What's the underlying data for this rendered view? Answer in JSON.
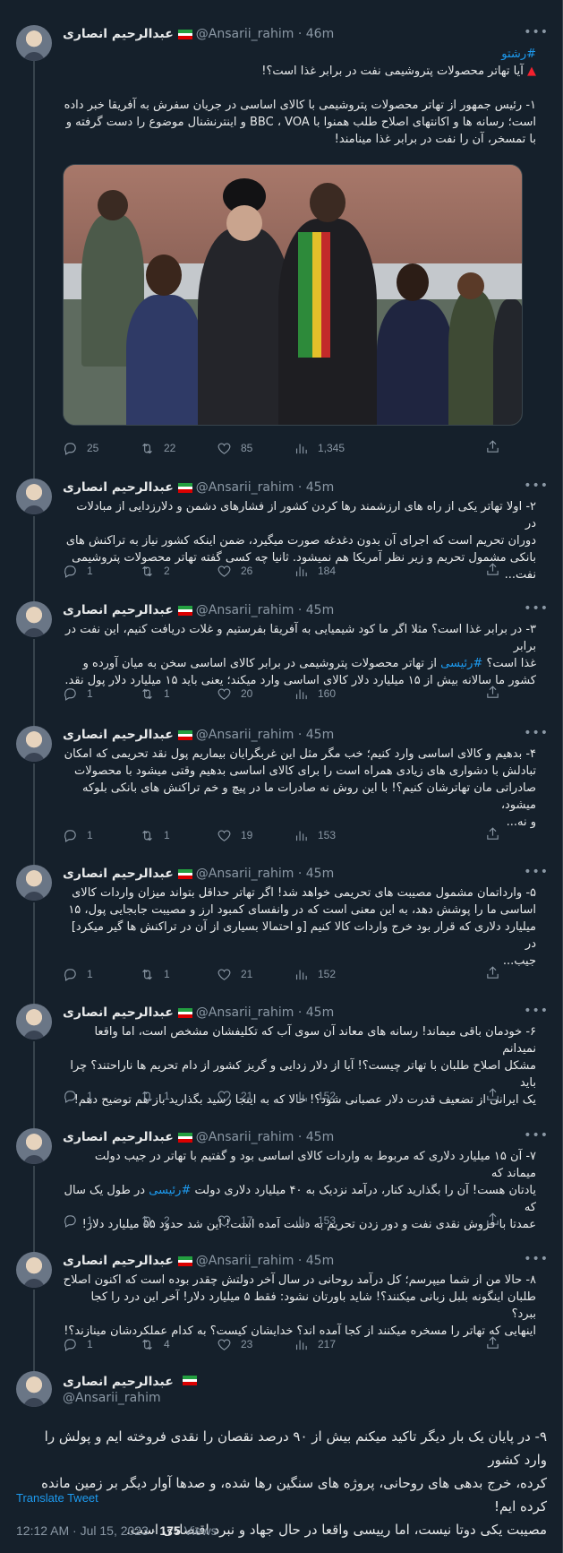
{
  "author": {
    "name": "عبدالرحیم انصاری",
    "handle": "@Ansarii_rahim"
  },
  "tweets": [
    {
      "time": "46m",
      "hashtag": "#رشتو",
      "title": "آیا تهاتر محصولات پتروشیمی نفت در برابر غذا است؟!",
      "lines": [
        "۱- رئیس جمهور از تهاتر محصولات پتروشیمی با کالای اساسی در جریان سفرش به آفریقا خبر داده",
        "است؛ رسانه ها و اکانتهای اصلاح طلب همنوا با BBC ، VOA و اینترنشنال موضوع را دست گرفته و",
        "با تمسخر، آن را نفت در برابر غذا مینامند!"
      ],
      "stats": {
        "replies": "25",
        "retweets": "22",
        "likes": "85",
        "views": "1,345"
      }
    },
    {
      "time": "45m",
      "lines": [
        "۲- اولا تهاتر یکی از راه های ارزشمند رها کردن کشور از فشارهای دشمن و دلارزدایی از مبادلات در",
        "دوران تحریم است که اجرای آن بدون دغدغه صورت میگیرد، ضمن اینکه کشور نیاز به تراکنش های",
        "بانکی مشمول تحریم و زیر نظر آمریکا هم نمیشود. ثانیا چه کسی گفته تهاتر محصولات پتروشیمی نفت..."
      ],
      "stats": {
        "replies": "1",
        "retweets": "2",
        "likes": "26",
        "views": "184"
      }
    },
    {
      "time": "45m",
      "lines": [
        "۳- در برابر غذا است؟ مثلا اگر ما کود شیمیایی به آفریقا بفرستیم و غلات دریافت کنیم، این نفت در برابر",
        "غذا است؟ #رئیسی از تهاتر محصولات پتروشیمی در برابر کالای اساسی سخن به میان آورده و",
        "کشور ما سالانه بیش از ۱۵ میلیارد دلار کالای اساسی وارد میکند؛ یعنی باید ۱۵ میلیارد دلار پول نقد."
      ],
      "stats": {
        "replies": "1",
        "retweets": "1",
        "likes": "20",
        "views": "160"
      }
    },
    {
      "time": "45m",
      "lines": [
        "۴- بدهیم و کالای اساسی وارد کنیم؛ خب مگر مثل این غربگرایان بیماریم پول نقد تحریمی که امکان",
        "تبادلش با دشواری های زیادی همراه است را برای کالای اساسی بدهیم وقتی میشود با محصولات",
        "صادراتی مان تهاترشان کنیم؟! با این روش نه صادرات ما در پیچ و خم تراکنش های بانکی بلوکه میشود،",
        "و نه..."
      ],
      "stats": {
        "replies": "1",
        "retweets": "1",
        "likes": "19",
        "views": "153"
      }
    },
    {
      "time": "45m",
      "lines": [
        "۵- وارداتمان مشمول مصیبت های تحریمی خواهد شد! اگر تهاتر حداقل بتواند میزان واردات کالای",
        "اساسی ما را پوشش دهد، به این معنی است که در وانفسای کمبود ارز و مصیبت جابجایی پول، ۱۵",
        "میلیارد دلاری که قرار بود خرج واردات کالا کنیم [و احتمالا بسیاری از آن در تراکنش ها گیر میکرد] در",
        "جیب..."
      ],
      "stats": {
        "replies": "1",
        "retweets": "1",
        "likes": "21",
        "views": "152"
      }
    },
    {
      "time": "45m",
      "lines": [
        "۶- خودمان باقی میماند! رسانه های معاند آن سوی آب که تکلیفشان مشخص است، اما واقعا نمیدانم",
        "مشکل اصلاح طلبان با تهاتر چیست؟! آیا از دلار زدایی و گریز کشور از دام تحریم ها ناراحتند؟ چرا باید",
        "یک ایرانی از تضعیف قدرت دلار عصبانی شود؟! حالا که به اینجا رسید بگذارید باز هم توضیح دهم!"
      ],
      "stats": {
        "replies": "1",
        "retweets": "1",
        "likes": "21",
        "views": "152"
      }
    },
    {
      "time": "45m",
      "lines": [
        "۷- آن ۱۵ میلیارد دلاری که مربوط به واردات کالای اساسی بود و گفتیم با تهاتر در جیب دولت میماند که",
        "یادتان هست! آن را بگذارید کنار، درآمد نزدیک به ۴۰ میلیارد دلاری دولت #رئیسی در طول یک سال که",
        "عمدتا با فروش نقدی نفت و دور زدن تحریم به دست آمده است! این شد حدود ۵۵ میلیارد دلار!"
      ],
      "stats": {
        "replies": "1",
        "retweets": "2",
        "likes": "17",
        "views": "153"
      }
    },
    {
      "time": "45m",
      "lines": [
        "۸- حالا من از شما میپرسم؛ کل درآمد روحانی در سال آخر دولتش چقدر بوده است که اکنون اصلاح",
        "طلبان اینگونه بلبل زبانی میکنند؟! شاید باورتان نشود: فقط ۵ میلیارد دلار! آخر این درد را کجا ببرد؟",
        "اینهایی که تهاتر را مسخره میکنند از کجا آمده اند؟ خدایشان کیست؟ به کدام عملکردشان مینازند؟!"
      ],
      "stats": {
        "replies": "1",
        "retweets": "4",
        "likes": "23",
        "views": "217"
      }
    }
  ],
  "final": {
    "lines": [
      "۹- در پایان یک بار دیگر تاکید میکنم بیش از ۹۰ درصد نقصان را نقدی فروخته ایم و پولش را وارد کشور",
      "کرده، خرج بدهی های روحانی، پروژه های سنگین رها شده، و صدها آوار دیگر بر زمین مانده کرده ایم!",
      "مصیبت یکی دوتا نیست، اما رییسی واقعا در حال جهاد و نبرد اقتصادی است."
    ],
    "translate": "Translate Tweet",
    "timestamp": "12:12 AM · Jul 15, 2023 · ",
    "views_count": "175",
    "views_label": " Views"
  },
  "icons": {
    "reply": "reply-icon",
    "retweet": "retweet-icon",
    "like": "heart-icon",
    "views": "analytics-icon",
    "share": "share-icon",
    "more": "more-icon",
    "flag": "iran-flag-icon"
  },
  "colors": {
    "background": "#15202b",
    "accent": "#1d9bf0",
    "muted": "#8b98a5",
    "divider": "#38444d"
  }
}
